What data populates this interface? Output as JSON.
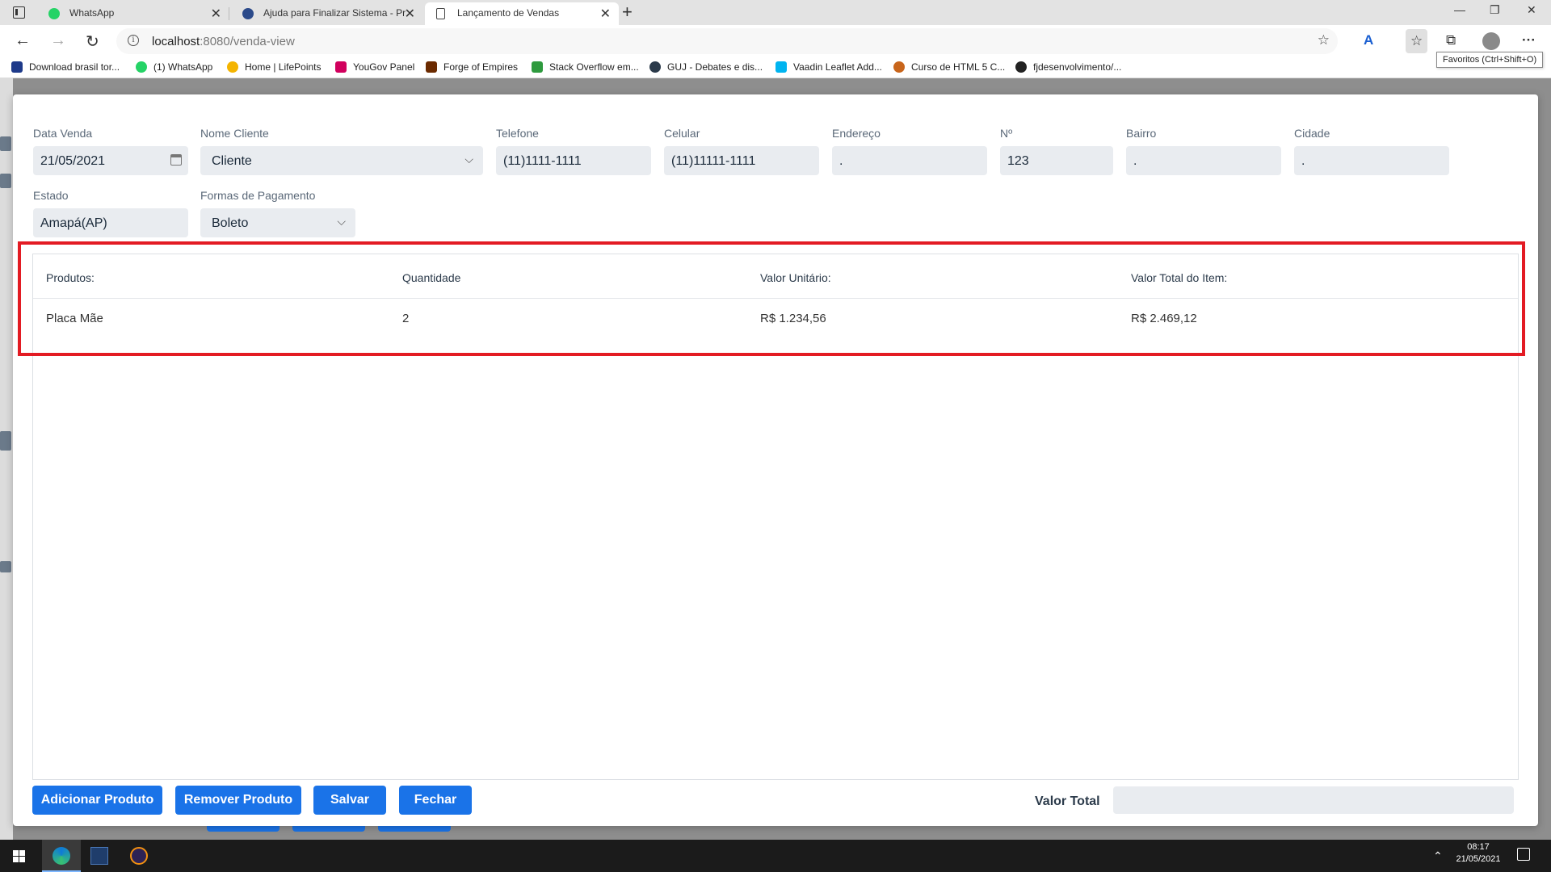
{
  "browser": {
    "tabs": [
      {
        "label": "WhatsApp",
        "active": false,
        "icon_color": "#25d366"
      },
      {
        "label": "Ajuda para Finalizar Sistema - Pr",
        "active": false,
        "icon_color": "#2b4a8a"
      },
      {
        "label": "Lançamento de Vendas",
        "active": true,
        "icon_color": "#ffffff"
      }
    ],
    "url_host": "localhost",
    "url_path": ":8080/venda-view",
    "favorites": [
      {
        "label": "Download brasil tor...",
        "icon_color": "#1e3a8a"
      },
      {
        "label": "(1) WhatsApp",
        "icon_color": "#25d366"
      },
      {
        "label": "Home | LifePoints",
        "icon_color": "#f4b400"
      },
      {
        "label": "YouGov Panel",
        "icon_color": "#d1005d"
      },
      {
        "label": "Forge of Empires",
        "icon_color": "#6b2a00"
      },
      {
        "label": "Stack Overflow em...",
        "icon_color": "#2e9a3e"
      },
      {
        "label": "GUJ - Debates e dis...",
        "icon_color": "#2b3a4a"
      },
      {
        "label": "Vaadin Leaflet Add...",
        "icon_color": "#00b4f0"
      },
      {
        "label": "Curso de HTML 5 C...",
        "icon_color": "#c8651b"
      },
      {
        "label": "fjdesenvolvimento/...",
        "icon_color": "#222222"
      }
    ],
    "tooltip": "Favoritos (Ctrl+Shift+O)"
  },
  "form": {
    "fields_row1": [
      {
        "label": "Data Venda",
        "value": "21/05/2021"
      },
      {
        "label": "Nome Cliente",
        "value": "Cliente"
      },
      {
        "label": "Telefone",
        "value": "(11)1111-1111"
      },
      {
        "label": "Celular",
        "value": "(11)11111-1111"
      },
      {
        "label": "Endereço",
        "value": "."
      },
      {
        "label": "Nº",
        "value": "123"
      },
      {
        "label": "Bairro",
        "value": "."
      },
      {
        "label": "Cidade",
        "value": "."
      }
    ],
    "fields_row2": [
      {
        "label": "Estado",
        "value": "Amapá(AP)"
      },
      {
        "label": "Formas de Pagamento",
        "value": "Boleto"
      }
    ]
  },
  "grid": {
    "columns": [
      "Produtos:",
      "Quantidade",
      "Valor Unitário:",
      "Valor Total do Item:"
    ],
    "rows": [
      [
        "Placa Mãe",
        "2",
        "R$ 1.234,56",
        "R$ 2.469,12"
      ]
    ]
  },
  "actions": {
    "add": "Adicionar Produto",
    "remove": "Remover Produto",
    "save": "Salvar",
    "close": "Fechar",
    "total_label": "Valor Total",
    "total_value": ""
  },
  "taskbar": {
    "time": "08:17",
    "date": "21/05/2021"
  },
  "colors": {
    "primary": "#1a73e8",
    "highlight": "#e31b23",
    "input_bg": "#e9ecf0"
  }
}
